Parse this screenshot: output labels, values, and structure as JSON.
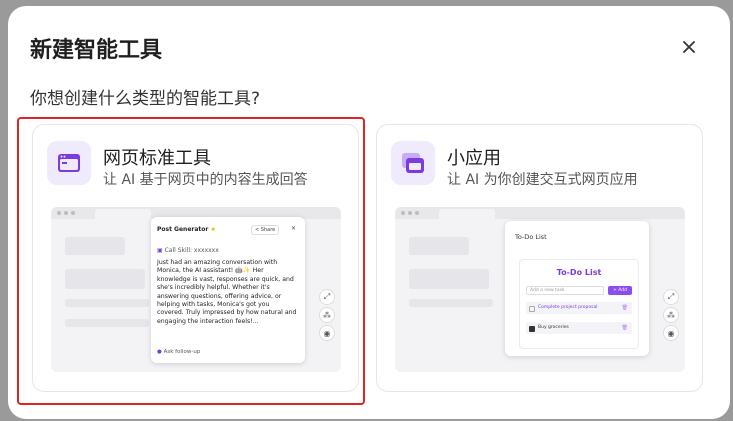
{
  "modal": {
    "title": "新建智能工具",
    "subtitle": "你想创建什么类型的智能工具?",
    "close_icon": "close-icon"
  },
  "cards": [
    {
      "title": "网页标准工具",
      "description": "让 AI 基于网页中的内容生成回答",
      "icon": "browser-window-icon",
      "selected": true,
      "preview": {
        "chat_title": "Post Generator",
        "share_label": "Share",
        "skill_label": "Call Skill: xxxxxxx",
        "message": "Just had an amazing conversation with Monica, the AI assistant! 🤖✨ Her knowledge is vast, responses are quick, and she's incredibly helpful. Whether it's answering questions, offering advice, or helping with tasks, Monica's got you covered. Truly impressed by how natural and engaging the interaction feels!...",
        "followup_placeholder": "Ask follow-up"
      }
    },
    {
      "title": "小应用",
      "description": "让 AI 为你创建交互式网页应用",
      "icon": "app-windows-icon",
      "selected": false,
      "preview": {
        "panel_title": "To-Do List",
        "card_title": "To-Do List",
        "input_placeholder": "Add a new task",
        "add_label": "+ Add",
        "tasks": [
          "Complete project proposal",
          "Buy groceries"
        ]
      }
    }
  ],
  "colors": {
    "accent": "#7a3be0",
    "highlight_border": "#e02424",
    "icon_bg": "#efeafc"
  }
}
